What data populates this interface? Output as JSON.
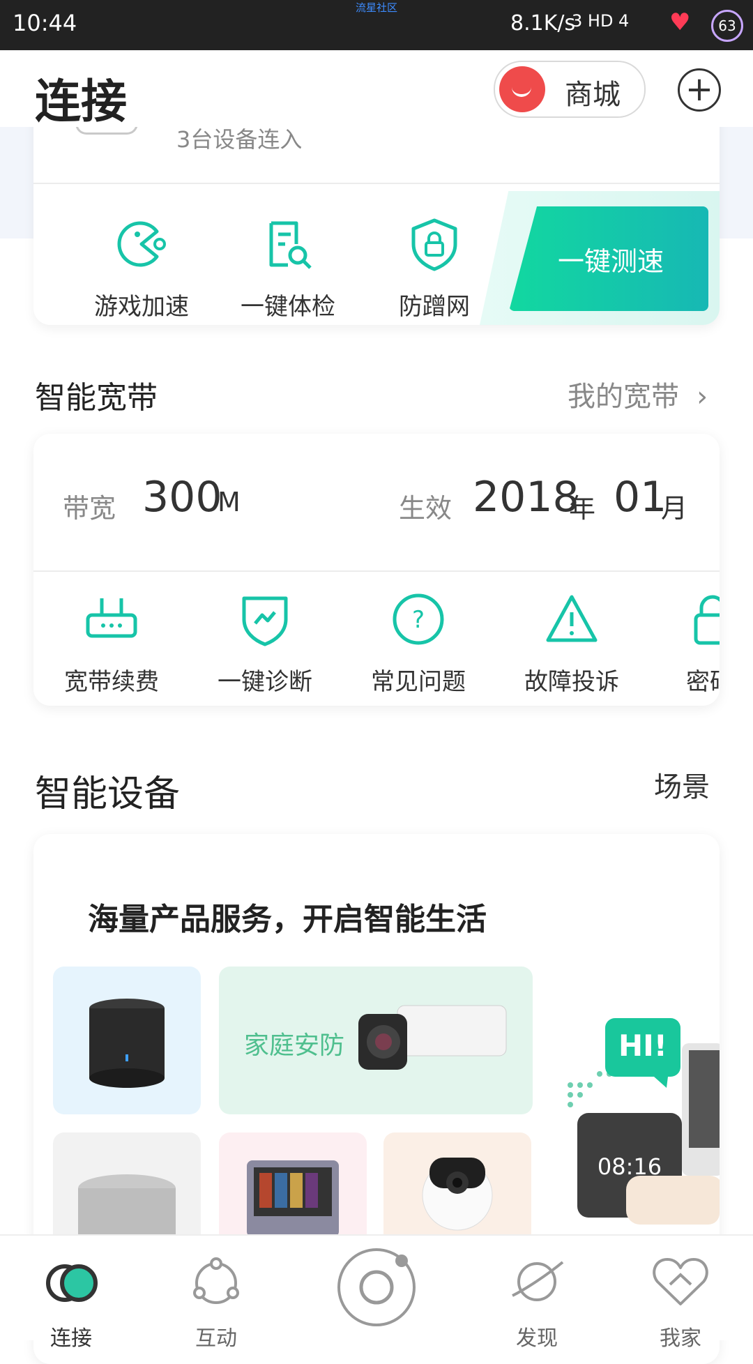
{
  "status_bar": {
    "time": "10:44",
    "center_text": "流星社区",
    "net_speed": "8.1K/s",
    "signal_text": "3 HD 4",
    "battery": "63"
  },
  "header": {
    "title": "连接",
    "mall_label": "商城"
  },
  "top_card": {
    "device_count": "3台设备连入",
    "actions": [
      "游戏加速",
      "一键体检",
      "防蹭网"
    ],
    "speed_test": "一键测速"
  },
  "broadband": {
    "section_title": "智能宽带",
    "my_link": "我的宽带",
    "bandwidth_label": "带宽",
    "bandwidth_value": "300",
    "bandwidth_unit": "M",
    "effective_label": "生效",
    "year": "2018",
    "year_unit": "年",
    "month": "01",
    "month_unit": "月",
    "services": [
      "宽带续费",
      "一键诊断",
      "常见问题",
      "故障投诉",
      "密码"
    ]
  },
  "devices": {
    "section_title": "智能设备",
    "scene_link": "场景",
    "promo": "海量产品服务，开启智能生活",
    "security_label": "家庭安防",
    "hi_bubble": "HI!",
    "clock_text": "08:16"
  },
  "bottom_nav": {
    "items": [
      "连接",
      "互动",
      "",
      "发现",
      "我家"
    ]
  },
  "colors": {
    "accent": "#17c4a8",
    "status_bar": "#222222"
  }
}
